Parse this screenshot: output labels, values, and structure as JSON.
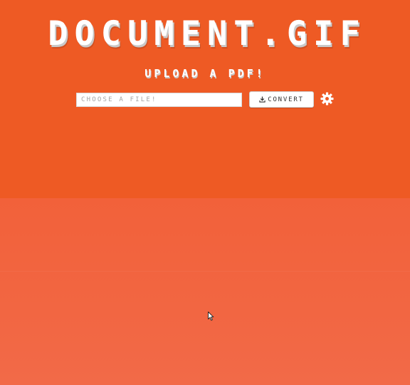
{
  "header": {
    "title": "DOCUMENT.GIF",
    "subtitle": "UPLOAD A PDF!"
  },
  "upload_form": {
    "file_input": {
      "placeholder": "CHOOSE A FILE!",
      "value": ""
    },
    "convert_button": {
      "label": "CONVERT",
      "icon": "download-icon"
    },
    "settings": {
      "icon": "gear-icon"
    }
  },
  "colors": {
    "header_background": "#ee5a24",
    "lower_background": "#f2653f",
    "text": "#ffffff",
    "text_shadow": "#c9c9c9"
  }
}
